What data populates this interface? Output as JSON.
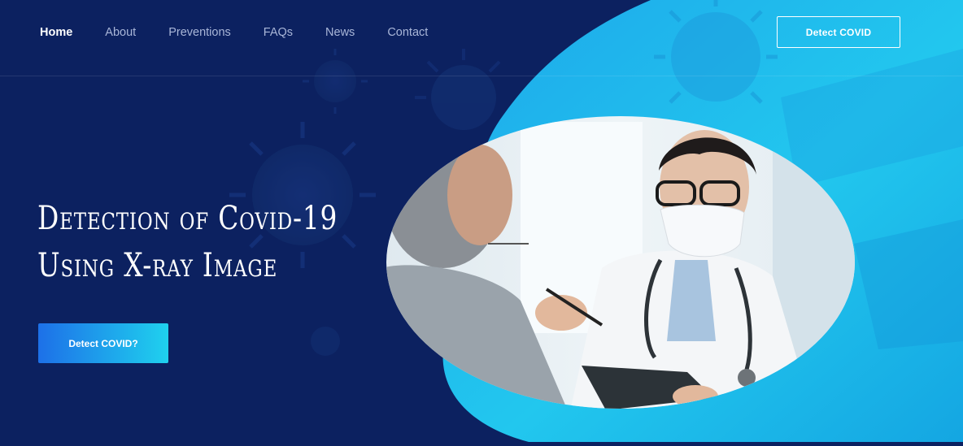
{
  "nav": {
    "items": [
      {
        "label": "Home",
        "active": true
      },
      {
        "label": "About",
        "active": false
      },
      {
        "label": "Preventions",
        "active": false
      },
      {
        "label": "FAQs",
        "active": false
      },
      {
        "label": "News",
        "active": false
      },
      {
        "label": "Contact",
        "active": false
      }
    ],
    "detect_button_label": "Detect COVID"
  },
  "hero": {
    "headline_line1": "Detection of Covid-19",
    "headline_line2": "Using X-ray Image",
    "cta_label": "Detect COVID?"
  },
  "colors": {
    "background_dark": "#0c2160",
    "accent_cyan": "#1fd1ee",
    "accent_blue": "#1d70e8"
  },
  "icons": {
    "virus_decoration": "virus-icon"
  }
}
